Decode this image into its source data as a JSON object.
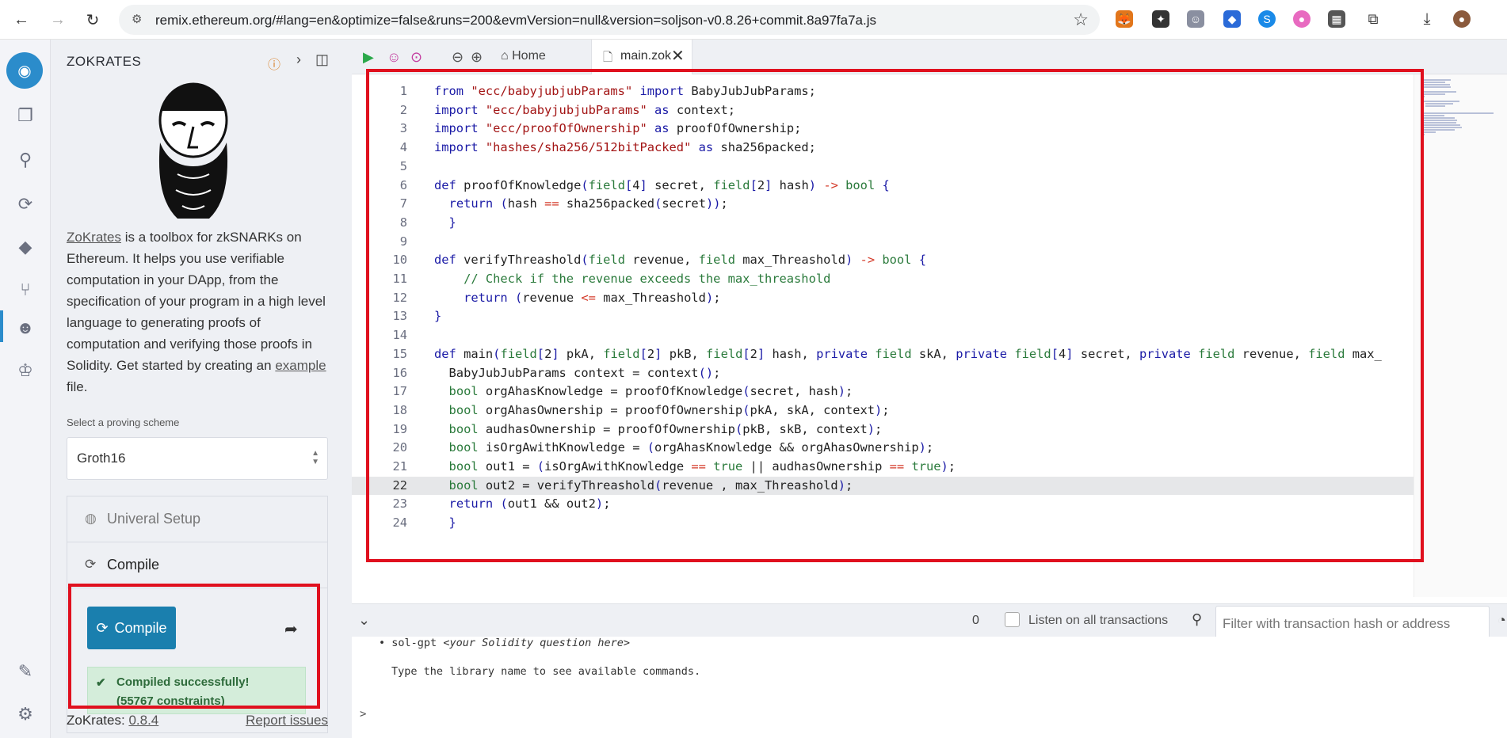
{
  "browser": {
    "url": "remix.ethereum.org/#lang=en&optimize=false&runs=200&evmVersion=null&version=soljson-v0.8.26+commit.8a97fa7a.js"
  },
  "panel": {
    "title": "ZOKRATES",
    "description_link": "ZoKrates",
    "description_text": " is a toolbox for zkSNARKs on Ethereum. It helps you use verifiable computation in your DApp, from the specification of your program in a high level language to generating proofs of computation and verifying those proofs in Solidity. Get started by creating an ",
    "description_link2": "example",
    "description_tail": " file.",
    "scheme_label": "Select a proving scheme",
    "scheme_value": "Groth16",
    "accordion": {
      "setup_label": "Univeral Setup",
      "compile_label": "Compile"
    },
    "compile_button": "Compile",
    "success_line1": "Compiled successfully!",
    "success_line2": "(55767 constraints)",
    "footer_name": "ZoKrates:",
    "footer_version": "0.8.4",
    "footer_report": "Report issues"
  },
  "tabs": {
    "home": "Home",
    "file": "main.zok"
  },
  "editor": {
    "highlighted_line": 22,
    "lines": [
      "from \"ecc/babyjubjubParams\" import BabyJubJubParams;",
      "import \"ecc/babyjubjubParams\" as context;",
      "import \"ecc/proofOfOwnership\" as proofOfOwnership;",
      "import \"hashes/sha256/512bitPacked\" as sha256packed;",
      "",
      "def proofOfKnowledge(field[4] secret, field[2] hash) -> bool {",
      "  return (hash == sha256packed(secret));",
      "  }",
      "",
      "def verifyThreashold(field revenue, field max_Threashold) -> bool {",
      "    // Check if the revenue exceeds the max_threashold",
      "    return (revenue <= max_Threashold);",
      "}",
      "",
      "def main(field[2] pkA, field[2] pkB, field[2] hash, private field skA, private field[4] secret, private field revenue, field max_",
      "  BabyJubJubParams context = context();",
      "  bool orgAhasKnowledge = proofOfKnowledge(secret, hash);",
      "  bool orgAhasOwnership = proofOfOwnership(pkA, skA, context);",
      "  bool audhasOwnership = proofOfOwnership(pkB, skB, context);",
      "  bool isOrgAwithKnowledge = (orgAhasKnowledge && orgAhasOwnership);",
      "  bool out1 = (isOrgAwithKnowledge == true || audhasOwnership == true);",
      "  bool out2 = verifyThreashold(revenue , max_Threashold);",
      "  return (out1 && out2);",
      "  }"
    ]
  },
  "terminal": {
    "tx_count": "0",
    "listen_label": "Listen on all transactions",
    "filter_placeholder": "Filter with transaction hash or address",
    "line1_cmd": "sol-gpt",
    "line1_hint": "<your Solidity question here>",
    "line2": "Type the library name to see available commands.",
    "prompt": ">"
  },
  "colors": {
    "keyword": "#1a1aa6",
    "type": "#2a7a3b",
    "string": "#a31515",
    "comment": "#2a7a3b",
    "operator": "#d43b2a",
    "accent": "#1a7fae",
    "highlight_box": "#e0101e"
  }
}
